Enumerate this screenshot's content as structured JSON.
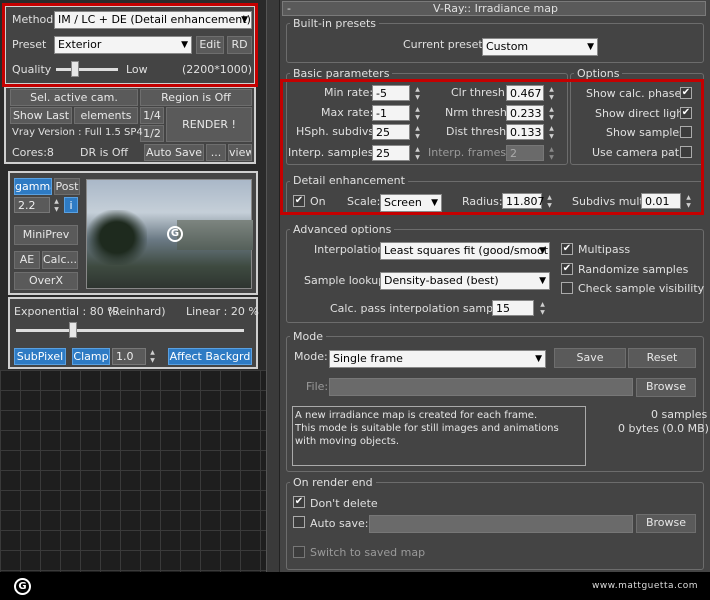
{
  "left": {
    "method_label": "Method",
    "method_value": "IM / LC + DE (Detail enhancement)",
    "preset_label": "Preset",
    "preset_value": "Exterior",
    "edit": "Edit",
    "rd": "RD",
    "quality_label": "Quality",
    "quality_low": "Low",
    "quality_res": "(2200*1000)",
    "quality_level": 0.3,
    "sel_cam": "Sel. active cam.",
    "region": "Region is Off",
    "show_last": "Show Last",
    "elements": "elements",
    "quarter": "1/4",
    "half": "1/2",
    "render": "RENDER !",
    "vray_version": "Vray Version : Full 1.5 SP4",
    "cores": "Cores:8",
    "dr": "DR is Off",
    "auto_save": "Auto Save",
    "dots": "...",
    "view": "view",
    "gamma": "gamma",
    "post": "Post",
    "gamma_val": "2.2",
    "info": "i",
    "miniprev": "MiniPrev",
    "ae": "AE",
    "calc": "Calc...",
    "overx": "OverX",
    "exponential": "Exponential : 80 %",
    "reinhard": "(Reinhard)",
    "linear": "Linear : 20 %",
    "exp_level": 0.8,
    "subpixel": "SubPixel",
    "clamp": "Clamp",
    "clamp_val": "1.0",
    "affect": "Affect Backgrd"
  },
  "right": {
    "minus": "-",
    "title": "V-Ray:: Irradiance map",
    "builtin": "Built-in presets",
    "current_preset": "Current preset:",
    "preset_value": "Custom",
    "basic": "Basic parameters",
    "options": "Options",
    "min_rate": "Min rate:",
    "min_rate_v": "-5",
    "max_rate": "Max rate:",
    "max_rate_v": "-1",
    "hsph": "HSph. subdivs:",
    "hsph_v": "25",
    "interp_samples": "Interp. samples:",
    "interp_samples_v": "25",
    "clr": "Clr thresh:",
    "clr_v": "0.467",
    "nrm": "Nrm thresh:",
    "nrm_v": "0.233",
    "dist": "Dist thresh:",
    "dist_v": "0.133",
    "interp_frames": "Interp. frames:",
    "interp_frames_v": "2",
    "show_calc": "Show calc. phase",
    "show_direct": "Show direct light",
    "show_samples": "Show samples",
    "use_camera": "Use camera path",
    "detail": "Detail enhancement",
    "on": "On",
    "scale": "Scale:",
    "scale_v": "Screen",
    "radius": "Radius:",
    "radius_v": "11.807",
    "subdivs_mult": "Subdivs mult.",
    "subdivs_mult_v": "0.01",
    "advanced": "Advanced options",
    "interpolation": "Interpolation",
    "interpolation_v": "Least squares fit (good/smooth",
    "sample_lookup": "Sample lookup:",
    "sample_lookup_v": "Density-based (best)",
    "calc_pass": "Calc. pass interpolation samples:",
    "calc_pass_v": "15",
    "multipass": "Multipass",
    "randomize": "Randomize samples",
    "check_vis": "Check sample visibility",
    "mode": "Mode",
    "mode_label": "Mode:",
    "mode_v": "Single frame",
    "save": "Save",
    "reset": "Reset",
    "file": "File:",
    "browse": "Browse",
    "info_text": "A new irradiance map is created for each frame.\nThis mode is suitable for still images and animations with moving objects.",
    "samples": "0 samples",
    "bytes": "0 bytes (0.0 MB)",
    "on_render_end": "On render end",
    "dont_delete": "Don't delete",
    "auto_save": "Auto save:",
    "browse2": "Browse",
    "switch": "Switch to saved map"
  },
  "footer": {
    "url": "www.mattguetta.com"
  },
  "colors": {
    "highlight_red": "#c40000",
    "button_blue": "#2e7bc4"
  }
}
